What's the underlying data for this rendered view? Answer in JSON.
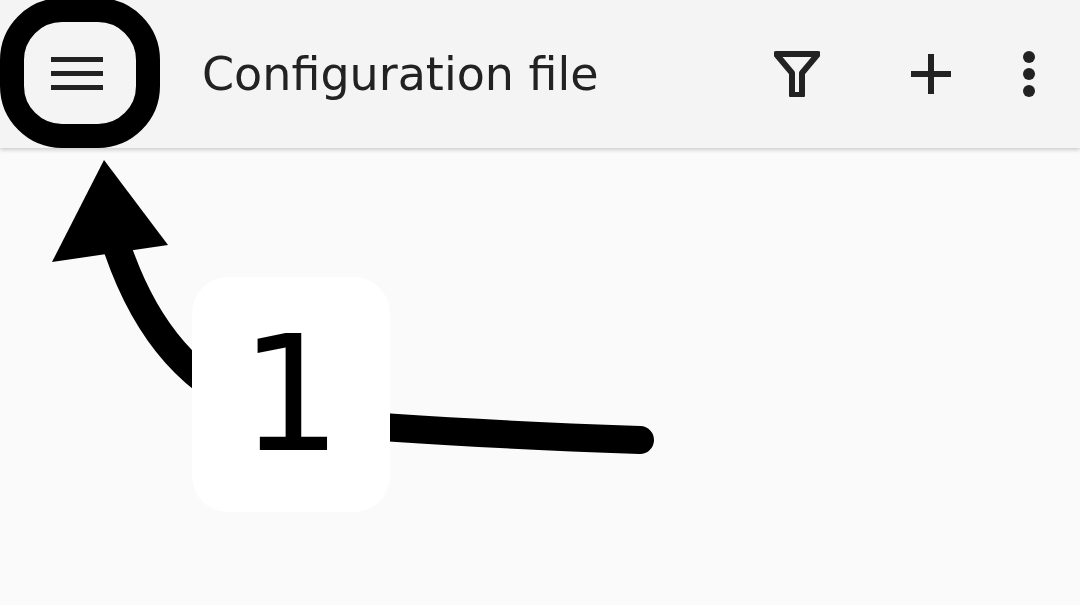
{
  "app_bar": {
    "title": "Configuration file"
  },
  "annotation": {
    "label": "1"
  }
}
